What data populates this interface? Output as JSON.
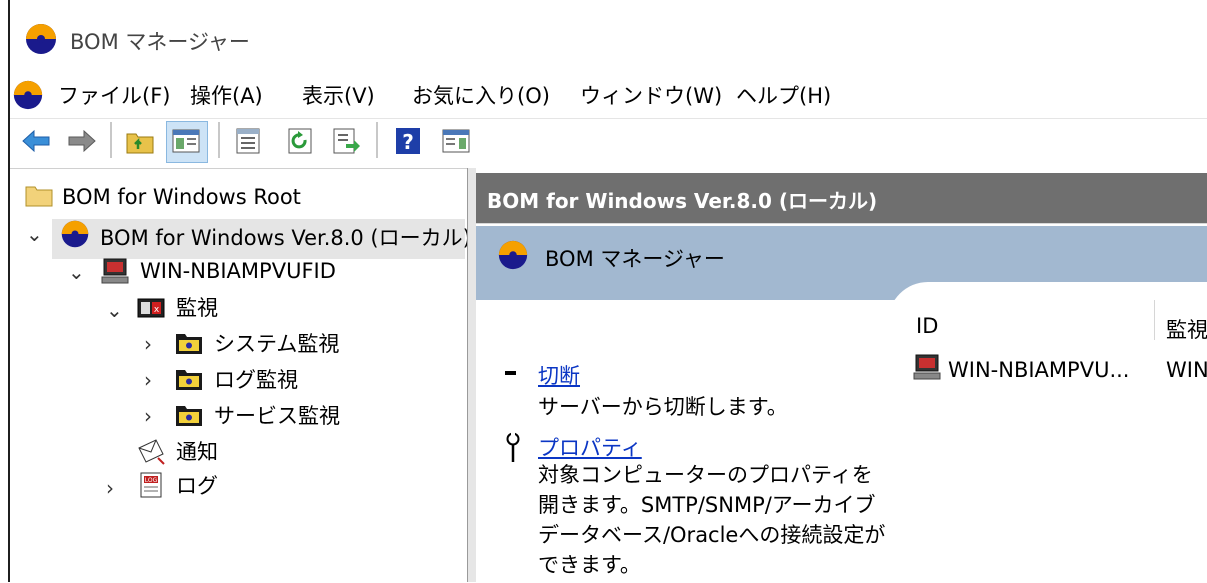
{
  "window": {
    "title": "BOM マネージャー"
  },
  "menu": {
    "items": [
      "ファイル(F)",
      "操作(A)",
      "表示(V)",
      "お気に入り(O)",
      "ウィンドウ(W)",
      "ヘルプ(H)"
    ]
  },
  "toolbar": {
    "buttons": [
      "back-icon",
      "forward-icon",
      "up-folder-icon",
      "show-hide-tree-icon",
      "properties-icon",
      "refresh-icon",
      "export-list-icon",
      "help-icon",
      "show-hide-action-pane-icon"
    ]
  },
  "tree": {
    "root": "BOM for Windows Root",
    "instance": "BOM for Windows Ver.8.0 (ローカル)",
    "computer": "WIN-NBIAMPVUFID",
    "monitor": "監視",
    "system_monitor": "システム監視",
    "log_monitor": "ログ監視",
    "service_monitor": "サービス監視",
    "notify": "通知",
    "log": "ログ"
  },
  "right_pane": {
    "header": "BOM for Windows Ver.8.0 (ローカル)",
    "taskpad_title": "BOM マネージャー",
    "tasks": [
      {
        "link": "切断",
        "desc": "サーバーから切断します。"
      },
      {
        "link": "プロパティ",
        "desc": "対象コンピューターのプロパティを開きます。SMTP/SNMP/アーカイブデータベース/Oracleへの接続設定ができます。"
      }
    ],
    "list": {
      "columns": [
        "ID",
        "監視"
      ],
      "rows": [
        {
          "id": "WIN-NBIAMPVU...",
          "monitor": "WIN"
        }
      ]
    }
  },
  "colors": {
    "header_bg": "#6f6f6f",
    "taskpad_band": "#a2b8d0",
    "link": "#0b36c4",
    "selection": "#e5e5e5"
  }
}
